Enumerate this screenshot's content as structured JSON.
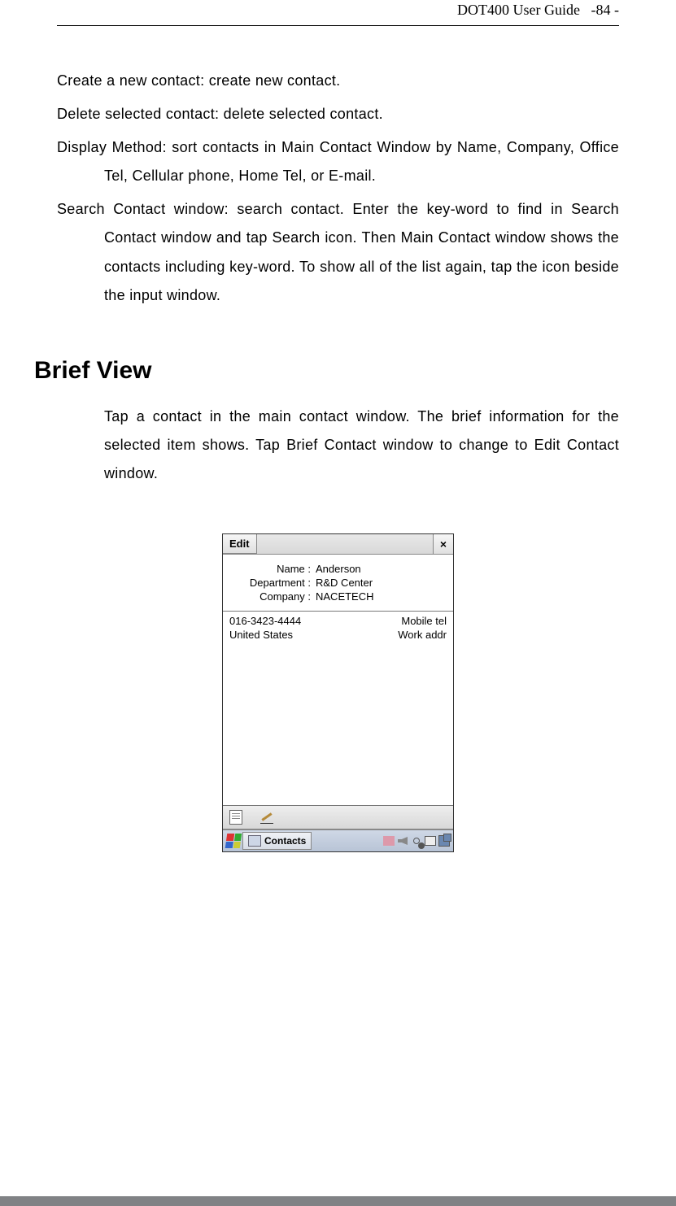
{
  "header": {
    "title": "DOT400 User Guide",
    "page": "-84 -"
  },
  "paragraphs": {
    "p1": "Create a new contact: create new contact.",
    "p2": "Delete selected contact: delete selected contact.",
    "p3": "Display Method: sort contacts in Main Contact Window by Name, Company, Office Tel, Cellular phone, Home Tel, or E-mail.",
    "p4": "Search Contact window: search contact. Enter the key-word to find in Search Contact window and tap Search icon. Then Main Contact window shows the contacts including key-word. To show all of the list again, tap the icon beside the input window."
  },
  "section_heading": "Brief View",
  "brief_paragraph": "Tap a contact in the main contact window. The brief information for the selected item shows. Tap Brief Contact window to change to Edit Contact window.",
  "screenshot": {
    "edit_label": "Edit",
    "close_glyph": "×",
    "fields": {
      "name_label": "Name :",
      "name_value": "Anderson",
      "dept_label": "Department :",
      "dept_value": "R&D Center",
      "company_label": "Company :",
      "company_value": "NACETECH"
    },
    "list": [
      {
        "left": "016-3423-4444",
        "right": "Mobile tel"
      },
      {
        "left": "United States",
        "right": "Work addr"
      }
    ],
    "taskbar": {
      "app_label": "Contacts"
    }
  }
}
